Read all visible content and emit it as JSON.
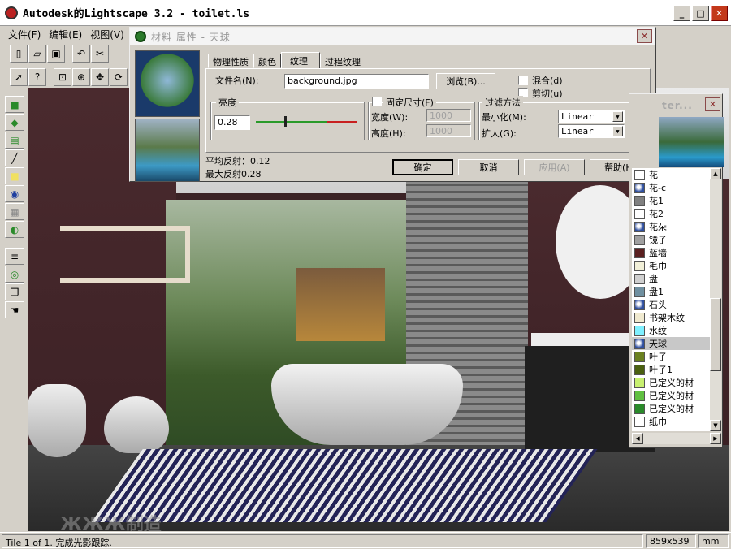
{
  "app": {
    "title": "Autodesk的Lightscape 3.2  - toilet.ls",
    "window_buttons": {
      "minimize": "_",
      "maximize": "□",
      "close": "✕"
    }
  },
  "menu": [
    "文件(F)",
    "编辑(E)",
    "视图(V)"
  ],
  "toolbar_icons": [
    "new-icon",
    "open-icon",
    "save-icon",
    "undo-icon",
    "cut-icon"
  ],
  "toolbar2_icons": [
    "select-arrow-icon",
    "help-arrow-icon",
    "zoom-window-icon",
    "zoom-icon",
    "pan-icon",
    "rotate-icon"
  ],
  "vertical_tool_icons": [
    "cube-green-icon",
    "arrow-green-icon",
    "layers-icon",
    "line-icon",
    "yellow-square-icon",
    "material-icon",
    "grid-icon",
    "orbit-icon",
    "layer-stack-icon",
    "search-icon",
    "copy-icon",
    "hand-icon"
  ],
  "dialog": {
    "title": "材料 属性 - 天球",
    "tabs": [
      "物理性质",
      "颜色",
      "纹理",
      "过程纹理"
    ],
    "active_tab": "纹理",
    "filename_label": "文件名(N):",
    "filename_value": "background.jpg",
    "browse_label": "浏览(B)...",
    "blend_label": "混合(d)",
    "cut_label": "剪切(u)",
    "brightness_group": "亮度",
    "brightness_value": "0.28",
    "brightness_fraction": 0.28,
    "fixed_size_label": "固定尺寸(F)",
    "width_label": "宽度(W):",
    "width_value": "1000",
    "height_label": "高度(H):",
    "height_value": "1000",
    "filter_group": "过滤方法",
    "minify_label": "最小化(M):",
    "minify_value": "Linear",
    "magnify_label": "扩大(G):",
    "magnify_value": "Linear",
    "avg_reflect": "平均反射：0.12",
    "max_reflect": "最大反射0.28",
    "ok_label": "确定",
    "cancel_label": "取消",
    "apply_label": "应用(A)",
    "help_label": "帮助(H)"
  },
  "materials_window": {
    "title": "ter...",
    "items": [
      {
        "name": "花",
        "swatch": "#ffffff",
        "icon": false
      },
      {
        "name": "花-c",
        "swatch": "#3050a0",
        "icon": true
      },
      {
        "name": "花1",
        "swatch": "#808080",
        "icon": false
      },
      {
        "name": "花2",
        "swatch": "#ffffff",
        "icon": false
      },
      {
        "name": "花朵",
        "swatch": "#3050a0",
        "icon": true
      },
      {
        "name": "镜子",
        "swatch": "#a0a0a0",
        "icon": false
      },
      {
        "name": "蓝墙",
        "swatch": "#5a2020",
        "icon": false
      },
      {
        "name": "毛巾",
        "swatch": "#f2f0d8",
        "icon": false
      },
      {
        "name": "盘",
        "swatch": "#d0d0d0",
        "icon": false
      },
      {
        "name": "盘1",
        "swatch": "#7090a0",
        "icon": false
      },
      {
        "name": "石头",
        "swatch": "#3050a0",
        "icon": true
      },
      {
        "name": "书架木纹",
        "swatch": "#f0ead0",
        "icon": false
      },
      {
        "name": "水纹",
        "swatch": "#7ff0ff",
        "icon": false
      },
      {
        "name": "天球",
        "swatch": "#3050a0",
        "icon": true,
        "selected": true
      },
      {
        "name": "叶子",
        "swatch": "#6a8020",
        "icon": false
      },
      {
        "name": "叶子1",
        "swatch": "#4a6010",
        "icon": false
      },
      {
        "name": "已定义的材",
        "swatch": "#c8f070",
        "icon": false
      },
      {
        "name": "已定义的材",
        "swatch": "#60c040",
        "icon": false
      },
      {
        "name": "已定义的材",
        "swatch": "#2a8a2a",
        "icon": false
      },
      {
        "name": "纸巾",
        "swatch": "#ffffff",
        "icon": false
      }
    ]
  },
  "status": {
    "left": "Tile 1 of 1. 完成光影跟踪.",
    "dims": "859x539",
    "units": "mm"
  },
  "watermark": "ЖЖЖ制造",
  "colors": {
    "slider_green": "#2a9a2a",
    "slider_red": "#c82020",
    "close_red": "#c3381a"
  }
}
